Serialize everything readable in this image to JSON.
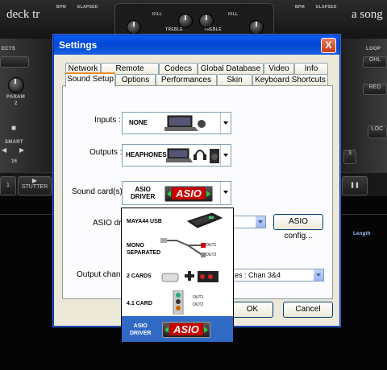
{
  "background_app": {
    "left_title": "deck tr",
    "right_title": "a song",
    "labels": {
      "bpm_l": "BPM",
      "elapsed_l": "ELAPSED",
      "kill_1": "KILL",
      "kill_2": "KILL",
      "treble_1": "TREBLE",
      "treble_2": "TREBLE",
      "bpm_r": "BPM",
      "elapsed_r": "ELAPSED",
      "effects": "ECTS",
      "param": "PARAM",
      "param_num": "2",
      "smart": "SMART",
      "loop": "LOOP",
      "stutter": "STUTTER",
      "length": "Length",
      "num_16": "16",
      "num_1": "1",
      "num_3": "3",
      "ohl": "OHL",
      "loc": "LOC",
      "red": "RED"
    }
  },
  "window": {
    "title": "Settings",
    "close_label": "X",
    "tabs_row1": [
      "Network",
      "Remote Control",
      "Codecs",
      "Global Database",
      "Video",
      "Info"
    ],
    "tabs_row2": [
      "Sound Setup",
      "Options",
      "Performances",
      "Skin",
      "Keyboard Shortcuts"
    ],
    "active_tab": "Sound Setup"
  },
  "sound_setup": {
    "inputs_label": "Inputs :",
    "inputs_value": "NONE",
    "outputs_label": "Outputs :",
    "outputs_value": "HEAPHONES",
    "soundcard_label": "Sound card(s) :",
    "soundcard_value_line1": "ASIO",
    "soundcard_value_line2": "DRIVER",
    "asio_driver_label": "ASIO driv",
    "asio_config_button": "ASIO config...",
    "output_channels_label": "Output channe",
    "output_channels_value": "es : Chan 3&4",
    "ok_button": "OK",
    "cancel_button": "Cancel"
  },
  "soundcard_options": [
    {
      "line1": "MAYA44 USB",
      "line2": ""
    },
    {
      "line1": "MONO",
      "line2": "SEPARATED",
      "out1": "OUT1",
      "out2": "OUT2"
    },
    {
      "line1": "2 CARDS",
      "line2": ""
    },
    {
      "line1": "4.1 CARD",
      "line2": "",
      "out1": "OUT1",
      "out2": "OUT2"
    },
    {
      "line1": "ASIO",
      "line2": "DRIVER"
    }
  ],
  "selected_option_index": 4,
  "logo_text": "ASIO",
  "colors": {
    "titlebar": "#0a5ef2",
    "selection": "#316ac5",
    "asio_red": "#c80000"
  }
}
